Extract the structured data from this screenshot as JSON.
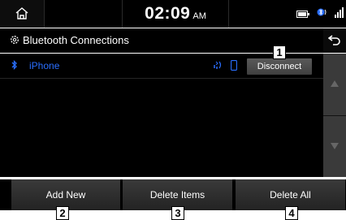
{
  "status_bar": {
    "time": "02:09",
    "ampm": "AM"
  },
  "title_bar": {
    "title": "Bluetooth Connections"
  },
  "devices": [
    {
      "name": "iPhone",
      "action_label": "Disconnect"
    }
  ],
  "bottom_buttons": {
    "add_new": "Add New",
    "delete_items": "Delete Items",
    "delete_all": "Delete All"
  },
  "callouts": [
    "1",
    "2",
    "3",
    "4"
  ],
  "colors": {
    "device_name": "#2a6fff",
    "background": "#000000"
  },
  "icons": [
    "home-icon",
    "battery-icon",
    "bluetooth-audio-icon",
    "signal-icon",
    "gear-icon",
    "back-icon",
    "bluetooth-icon",
    "audio-icon",
    "phone-icon",
    "scroll-up-icon",
    "scroll-down-icon"
  ]
}
